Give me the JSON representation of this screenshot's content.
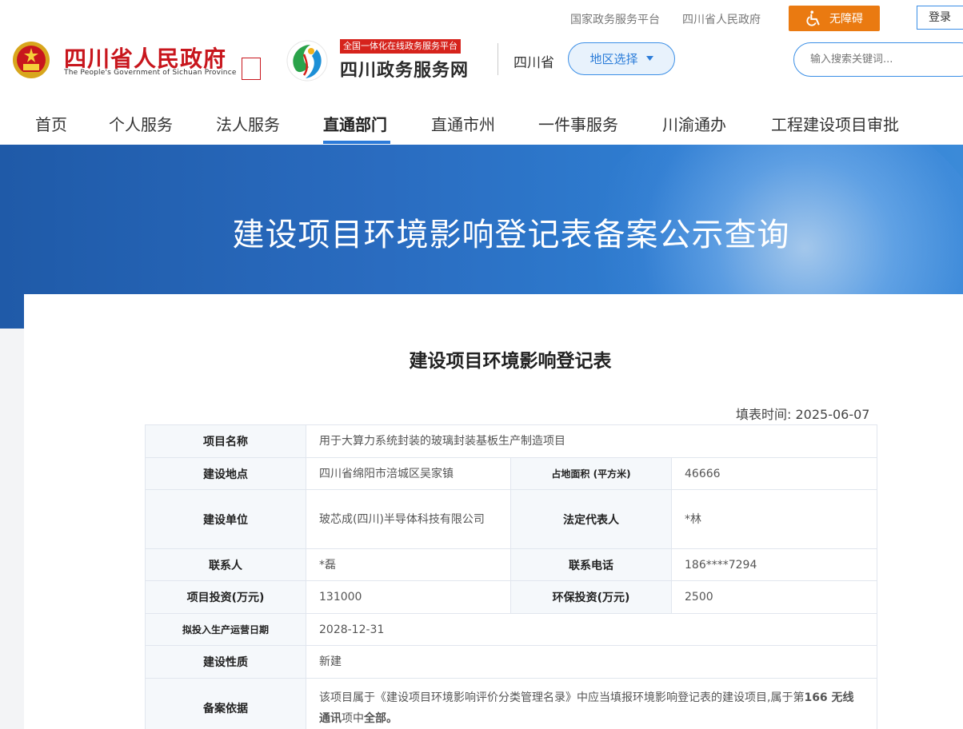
{
  "topbar": {
    "links": [
      "国家政务服务平台",
      "四川省人民政府"
    ],
    "accessibility_label": "无障碍",
    "login_label": "登录"
  },
  "header": {
    "gov_name": "四川省人民政府",
    "gov_name_en": "The People's Government of Sichuan Province",
    "platform_tag": "全国一体化在线政务服务平台",
    "platform_name": "四川政务服务网",
    "province": "四川省",
    "region_label": "地区选择",
    "search_placeholder": "输入搜索关键词..."
  },
  "nav": {
    "items": [
      "首页",
      "个人服务",
      "法人服务",
      "直通部门",
      "直通市州",
      "一件事服务",
      "川渝通办",
      "工程建设项目审批"
    ],
    "active": "直通部门"
  },
  "banner": {
    "title": "建设项目环境影响登记表备案公示查询"
  },
  "form": {
    "title": "建设项目环境影响登记表",
    "fill_time_label": "填表时间:",
    "fill_time": "2025-06-07",
    "rows": {
      "project_name": {
        "label": "项目名称",
        "value": "用于大算力系统封装的玻璃封装基板生产制造项目"
      },
      "location": {
        "label": "建设地点",
        "value": "四川省绵阳市涪城区吴家镇"
      },
      "area": {
        "label": "占地面积 (平方米)",
        "value": "46666"
      },
      "unit": {
        "label": "建设单位",
        "value": "玻芯成(四川)半导体科技有限公司"
      },
      "legal_rep": {
        "label": "法定代表人",
        "value": "*林"
      },
      "contact": {
        "label": "联系人",
        "value": "*磊"
      },
      "phone": {
        "label": "联系电话",
        "value": "186****7294"
      },
      "investment": {
        "label": "项目投资(万元)",
        "value": "131000"
      },
      "env_investment": {
        "label": "环保投资(万元)",
        "value": "2500"
      },
      "production_date": {
        "label": "拟投入生产运营日期",
        "value": "2028-12-31"
      },
      "nature": {
        "label": "建设性质",
        "value": "新建"
      },
      "basis": {
        "label": "备案依据",
        "value_pre": "该项目属于《建设项目环境影响评价分类管理名录》中应当填报环境影响登记表的建设项目,属于第",
        "value_bold1": "166 无线通讯",
        "value_mid": "项中",
        "value_bold2": "全部。"
      }
    }
  },
  "colors": {
    "accent": "#2b7ad9",
    "brand_red": "#c8161d",
    "a11y_orange": "#ea7a11"
  }
}
